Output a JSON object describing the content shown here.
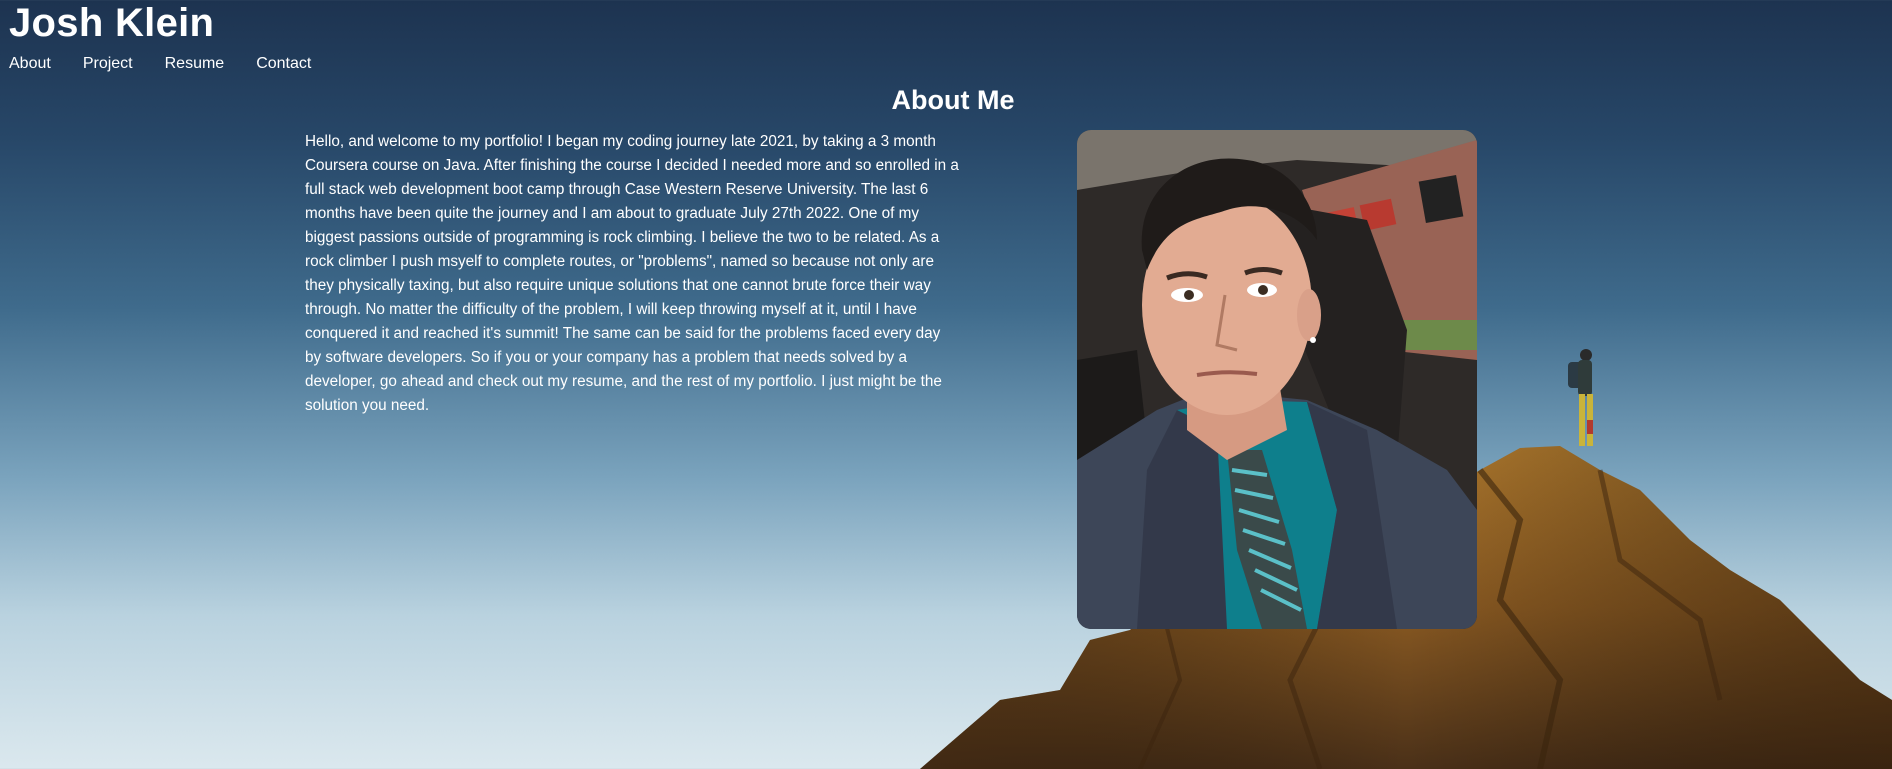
{
  "header": {
    "title": "Josh Klein"
  },
  "nav": {
    "items": [
      {
        "label": "About"
      },
      {
        "label": "Project"
      },
      {
        "label": "Resume"
      },
      {
        "label": "Contact"
      }
    ]
  },
  "about": {
    "heading": "About Me",
    "body": "Hello, and welcome to my portfolio! I began my coding journey late 2021, by taking a 3 month Coursera course on Java. After finishing the course I decided I needed more and so enrolled in a full stack web development boot camp through Case Western Reserve University. The last 6 months have been quite the journey and I am about to graduate July 27th 2022. One of my biggest passions outside of programming is rock climbing. I believe the two to be related. As a rock climber I push msyelf to complete routes, or \"problems\", named so because not only are they physically taxing, but also require unique solutions that one cannot brute force their way through. No matter the difficulty of the problem, I will keep throwing myself at it, until I have conquered it and reached it's summit! The same can be said for the problems faced every day by software developers. So if you or your company has a problem that needs solved by a developer, go ahead and check out my resume, and the rest of my portfolio. I just might be the solution you need."
  },
  "theme": {
    "sky_top": "#1d3350",
    "sky_bottom": "#dbe8ee",
    "rock": "#9a6a2a",
    "text": "#ffffff"
  },
  "icons": {
    "profile_photo": "portrait-photo",
    "background": "mountain-summit-image"
  }
}
